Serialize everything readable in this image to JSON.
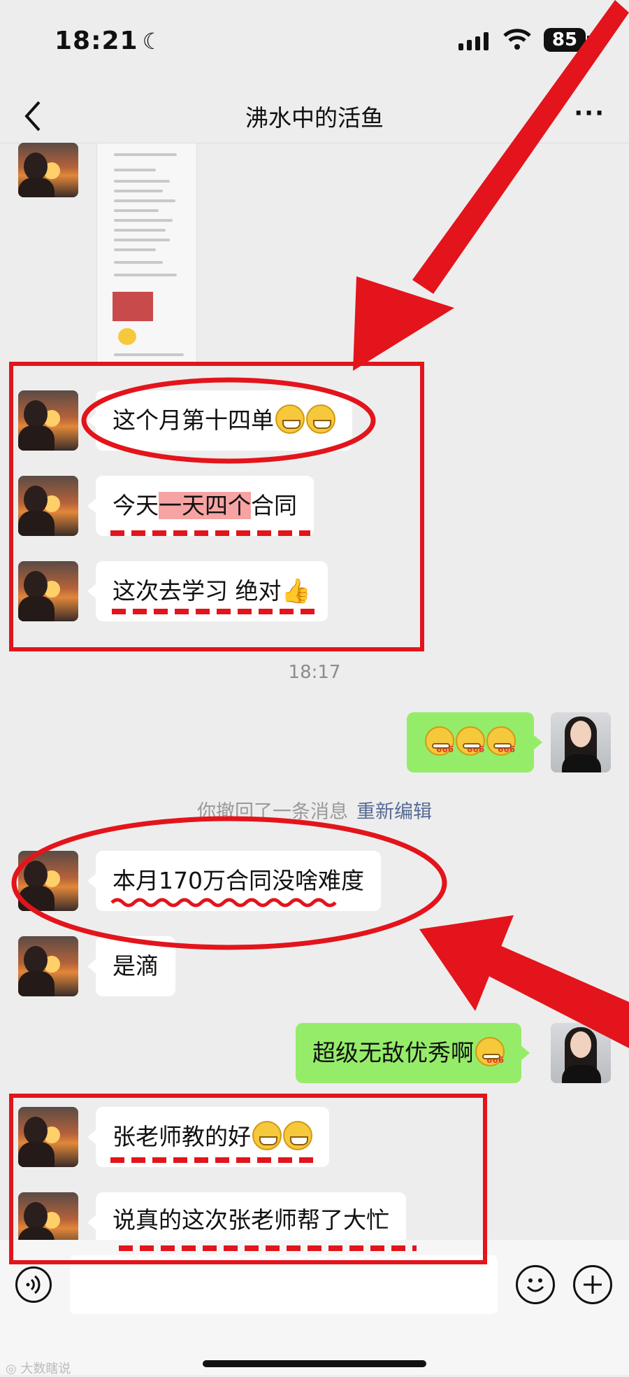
{
  "status": {
    "time": "18:21",
    "battery": "85"
  },
  "nav": {
    "title": "沸水中的活鱼"
  },
  "messages": {
    "m1": {
      "pre": "这个月第十四单"
    },
    "m2": {
      "pre": "今天",
      "hl": "一天四个",
      "post": "合同"
    },
    "m3": {
      "text": "这次去学习  绝对"
    },
    "timestamp": "18:17",
    "system": {
      "text": "你撤回了一条消息",
      "link": "重新编辑"
    },
    "m5": {
      "text": "本月170万合同没啥难度"
    },
    "m6": {
      "text": "是滴"
    },
    "m7": {
      "text": "超级无敌优秀啊"
    },
    "m8": {
      "text": "张老师教的好"
    },
    "m9": {
      "text": "说真的这次张老师帮了大忙"
    }
  },
  "watermark": "大数瞎说",
  "icons": {
    "voice": "voice-icon",
    "emoji": "emoji-icon",
    "plus": "plus-icon",
    "back": "back-chevron-icon",
    "more": "more-icon"
  },
  "colors": {
    "annotation_red": "#e3141b",
    "bubble_green": "#95ec69",
    "link_blue": "#576b95"
  }
}
